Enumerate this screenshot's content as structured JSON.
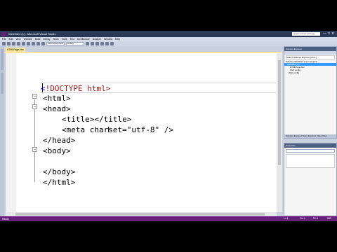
{
  "window": {
    "title": "WebSite4 (1) - Microsoft Visual Studio",
    "quick_launch_placeholder": "Quick Launch (Ctrl+Q)",
    "controls": [
      "—",
      "□",
      "✕"
    ]
  },
  "menu": {
    "items": [
      "File",
      "Edit",
      "View",
      "Website",
      "Build",
      "Debug",
      "Team",
      "Tools",
      "Test",
      "Architecture",
      "Analyze",
      "Window",
      "Help"
    ]
  },
  "toolbar": {
    "solution_config": "Debug",
    "browser_target": "Internet Explorer"
  },
  "editor": {
    "tab_label": "HTMLPage.htm",
    "lines": [
      "<!DOCTYPE html>",
      "<html>",
      "<head>",
      "<title></title>",
      "<meta charset=\"utf-8\" />",
      "</head>",
      "<body>",
      "",
      "</body>",
      "</html>"
    ]
  },
  "solution_explorer": {
    "title": "Solution Explorer",
    "search_placeholder": "Search Solution Explorer (Ctrl+;)",
    "items": [
      "Solution 'WebSite4 (1)' (1 project)",
      "WebSite4 (1)",
      "HTMLPage.htm",
      "Web.config",
      "Web.config"
    ],
    "bottom_tabs": "Solution Explorer  Team Explorer  Class View"
  },
  "properties": {
    "title": "Properties"
  },
  "status": {
    "left": "Ready",
    "ln": "Ln 1",
    "col": "Col 1",
    "ch": "Ch 1",
    "mode": "INS"
  },
  "colors": {
    "titlebar": "#293955",
    "status": "#68217a",
    "tab_active": "#fbe59b",
    "tag": "#a31515",
    "attr": "#ff0000",
    "value": "#0000ff"
  }
}
